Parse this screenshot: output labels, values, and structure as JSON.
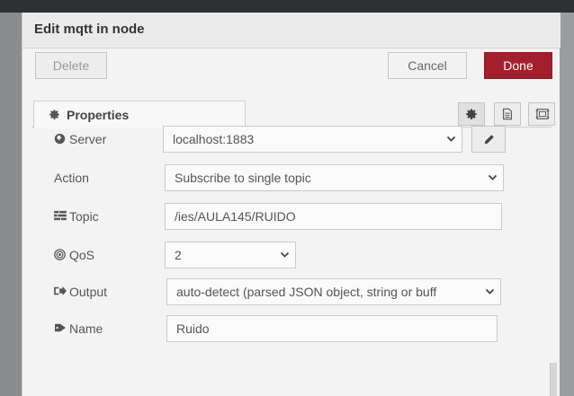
{
  "dialog": {
    "title": "Edit mqtt in node"
  },
  "toolbar": {
    "delete_label": "Delete",
    "cancel_label": "Cancel",
    "done_label": "Done"
  },
  "tabs": {
    "properties_label": "Properties",
    "icons": [
      "gear-icon",
      "document-icon",
      "frame-icon"
    ]
  },
  "form": {
    "server": {
      "label": "Server",
      "value": "localhost:1883",
      "icon": "globe-icon"
    },
    "action": {
      "label": "Action",
      "value": "Subscribe to single topic"
    },
    "topic": {
      "label": "Topic",
      "value": "/ies/AULA145/RUIDO",
      "icon": "tasks-icon"
    },
    "qos": {
      "label": "QoS",
      "value": "2",
      "icon": "target-icon"
    },
    "output": {
      "label": "Output",
      "value": "auto-detect (parsed JSON object, string or buff",
      "icon": "sign-out-icon"
    },
    "name": {
      "label": "Name",
      "value": "Ruido",
      "icon": "tag-icon"
    }
  },
  "colors": {
    "done_button": "#a41f2c",
    "panel_background": "#f3f3f3"
  }
}
